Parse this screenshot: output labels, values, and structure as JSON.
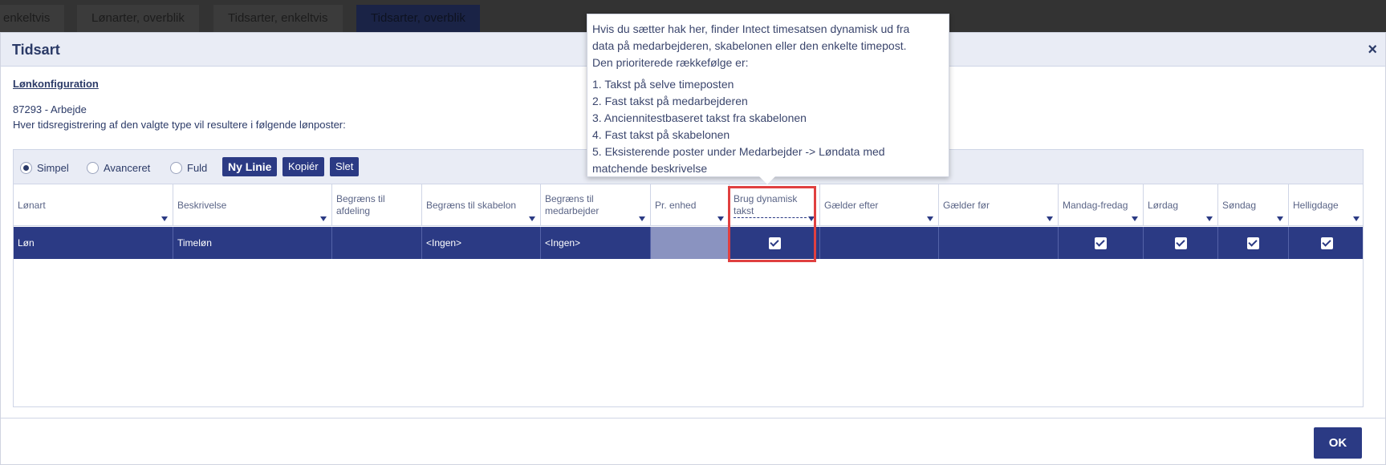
{
  "tabs": [
    {
      "label": "enkeltvis"
    },
    {
      "label": "Lønarter, overblik"
    },
    {
      "label": "Tidsarter, enkeltvis"
    },
    {
      "label": "Tidsarter, overblik"
    }
  ],
  "modal": {
    "title": "Tidsart",
    "close": "×",
    "section_link": "Lønkonfiguration",
    "line1": "87293 - Arbejde",
    "line2": "Hver tidsregistrering af den valgte type vil resultere i følgende lønposter:"
  },
  "toolbar": {
    "radios": [
      {
        "label": "Simpel",
        "selected": true
      },
      {
        "label": "Avanceret",
        "selected": false
      },
      {
        "label": "Fuld",
        "selected": false
      }
    ],
    "new_line": "Ny Linie",
    "copy": "Kopiér",
    "delete": "Slet"
  },
  "columns": [
    {
      "label": "Lønart"
    },
    {
      "label": "Beskrivelse"
    },
    {
      "label": "Begræns til afdeling"
    },
    {
      "label": "Begræns til skabelon"
    },
    {
      "label": "Begræns til medarbejder"
    },
    {
      "label": "Pr. enhed"
    },
    {
      "label": "Brug dynamisk takst"
    },
    {
      "label": "Gælder efter"
    },
    {
      "label": "Gælder før"
    },
    {
      "label": "Mandag-fredag"
    },
    {
      "label": "Lørdag"
    },
    {
      "label": "Søndag"
    },
    {
      "label": "Helligdage"
    }
  ],
  "row": {
    "lonart": "Løn",
    "beskrivelse": "Timeløn",
    "afdeling": "",
    "skabelon": "<Ingen>",
    "medarbejder": "<Ingen>",
    "pr_enhed": "",
    "dynamisk": true,
    "gaelder_efter": "",
    "gaelder_foer": "",
    "mandag_fredag": true,
    "loerdag": true,
    "soendag": true,
    "helligdage": true
  },
  "tooltip": {
    "line1": "Hvis du sætter hak her, finder Intect timesatsen dynamisk ud fra",
    "line2": "data på medarbejderen, skabelonen eller den enkelte timepost.",
    "line3": "Den prioriterede rækkefølge er:",
    "items": [
      "1. Takst på selve timeposten",
      "2. Fast takst på medarbejderen",
      "3. Anciennitestbaseret takst fra skabelonen",
      "4. Fast takst på skabelonen",
      "5. Eksisterende poster under Medarbejder -> Løndata med",
      "matchende beskrivelse"
    ]
  },
  "ok": "OK"
}
